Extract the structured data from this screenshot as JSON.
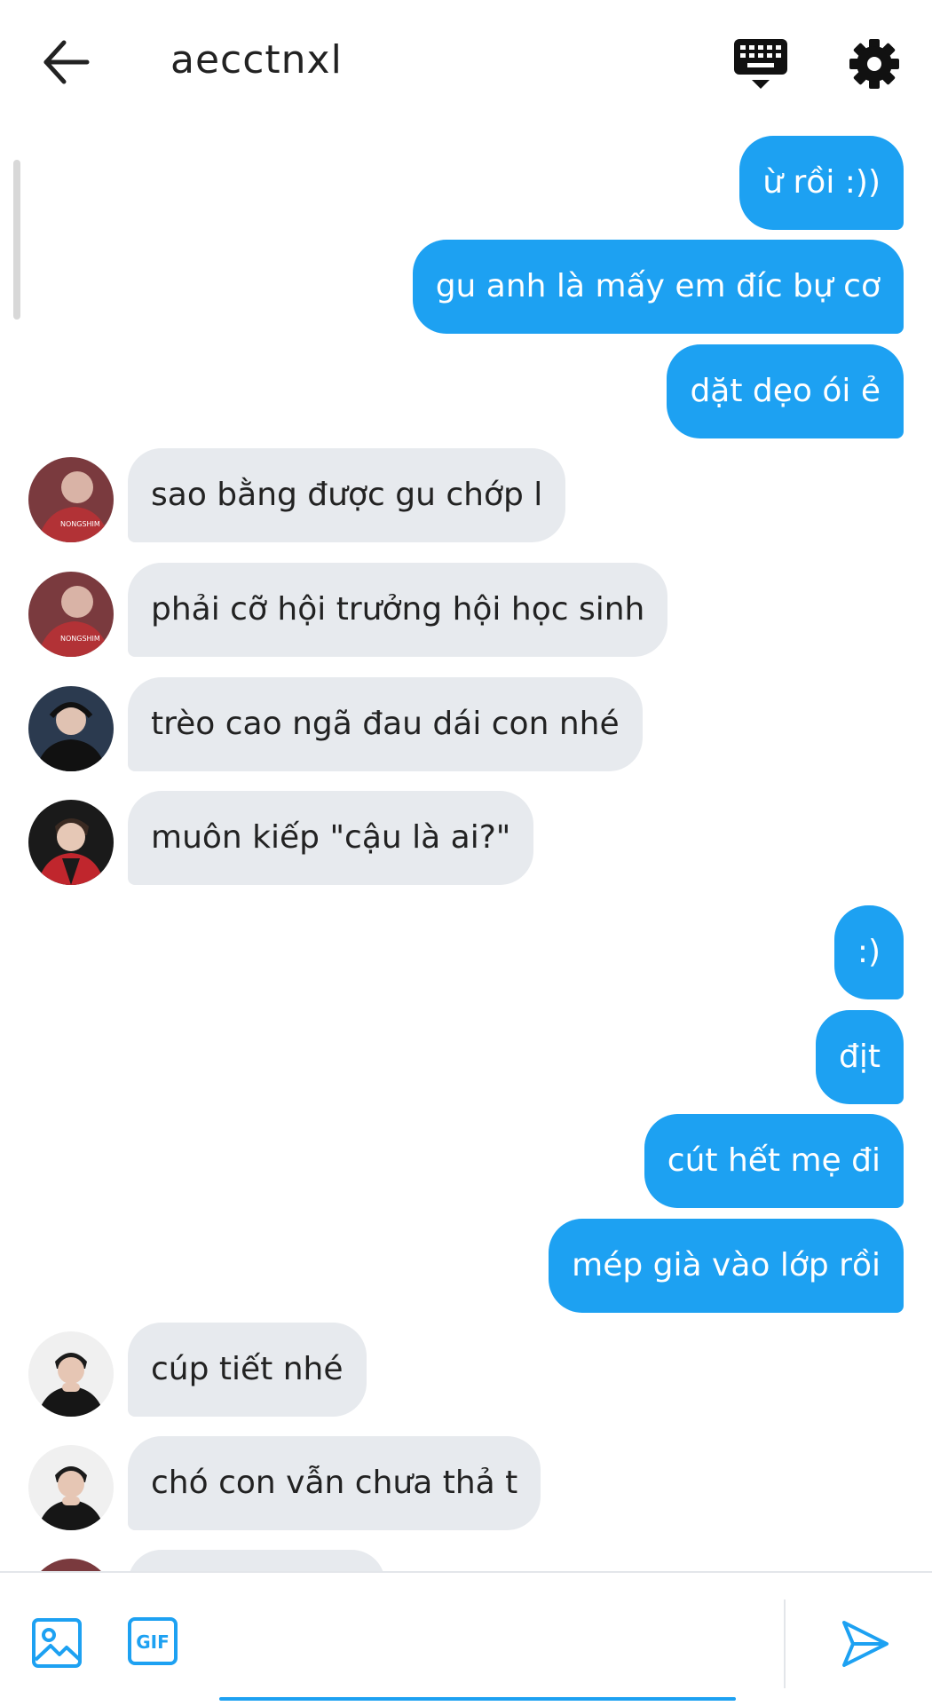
{
  "header": {
    "title": "aecctnxl",
    "back_icon": "arrow-left-icon",
    "keyboard_icon": "keyboard-icon",
    "settings_icon": "gear-icon"
  },
  "messages": [
    {
      "side": "sent",
      "text": "ừ rồi :))"
    },
    {
      "side": "sent",
      "text": "gu anh là mấy em đíc bự cơ"
    },
    {
      "side": "sent",
      "text": "dặt dẹo ói ẻ"
    },
    {
      "side": "received",
      "text": "sao bằng được gu chớp l",
      "avatar": "avatar-1"
    },
    {
      "side": "received",
      "text": "phải cỡ hội trưởng hội học sinh",
      "avatar": "avatar-1"
    },
    {
      "side": "received",
      "text": "trèo cao ngã đau dái con nhé",
      "avatar": "avatar-2"
    },
    {
      "side": "received",
      "text": "muôn kiếp \"cậu là ai?\"",
      "avatar": "avatar-3"
    },
    {
      "side": "sent",
      "text": ":)"
    },
    {
      "side": "sent",
      "text": "địt"
    },
    {
      "side": "sent",
      "text": "cút hết mẹ đi"
    },
    {
      "side": "sent",
      "text": "mép già vào lớp rồi"
    },
    {
      "side": "received",
      "text": "cúp tiết nhé",
      "avatar": "avatar-4"
    },
    {
      "side": "received",
      "text": "chó con vẫn chưa thả t",
      "avatar": "avatar-4"
    }
  ],
  "composer": {
    "image_icon": "image-icon",
    "gif_label": "GIF",
    "send_icon": "send-icon",
    "input_value": ""
  },
  "colors": {
    "accent": "#1da1f2",
    "received_bubble": "#e7eaee"
  }
}
